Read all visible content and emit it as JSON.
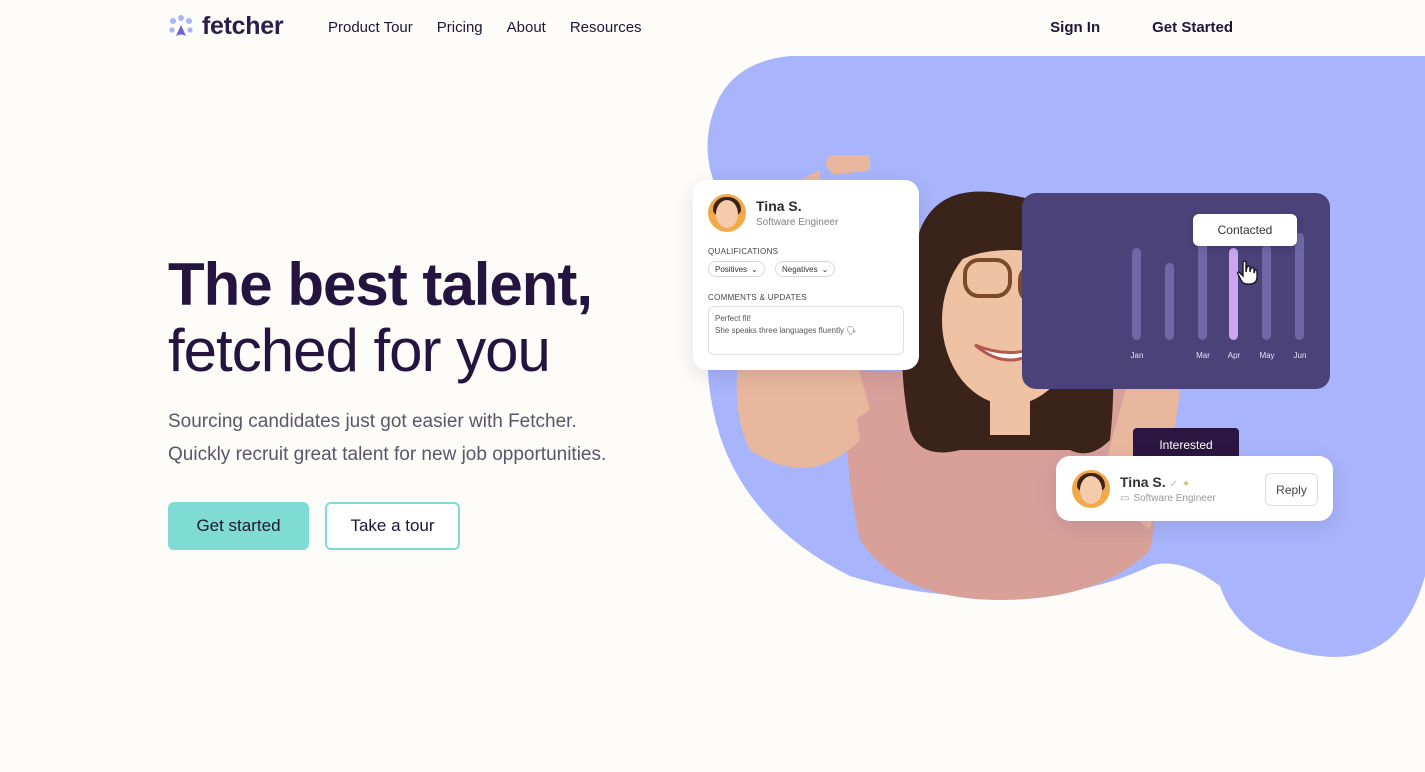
{
  "brand": {
    "name": "fetcher",
    "accent": "#7fdcd4",
    "blob_color": "#a8b4fb",
    "dark": "#24143f"
  },
  "nav": {
    "links": [
      "Product Tour",
      "Pricing",
      "About",
      "Resources"
    ],
    "sign_in": "Sign In",
    "get_started": "Get Started"
  },
  "hero": {
    "title_line1": "The best talent,",
    "title_line2": "fetched for you",
    "subtitle_line1": "Sourcing candidates just got easier with Fetcher.",
    "subtitle_line2": "Quickly recruit great talent for new job opportunities.",
    "cta_primary": "Get started",
    "cta_secondary": "Take a tour"
  },
  "profile_card": {
    "name": "Tina S.",
    "role": "Software Engineer",
    "qualifications_label": "QUALIFICATIONS",
    "positives_label": "Positives",
    "negatives_label": "Negatives",
    "comments_label": "COMMENTS & UPDATES",
    "comment_line1": "Perfect fit!",
    "comment_line2": "She speaks three languages fluently 🗣"
  },
  "chart_data": {
    "type": "bar",
    "categories": [
      "Jan",
      "",
      "Mar",
      "Apr",
      "May",
      "Jun"
    ],
    "highlighted": "Apr",
    "tooltip": "Contacted",
    "bar_color": "#7068a6",
    "highlight_color": "#c9a6ef",
    "background": "#4b4279"
  },
  "status_tooltip": "Interested",
  "reply_card": {
    "name": "Tina S.",
    "role": "Software Engineer",
    "reply_label": "Reply"
  }
}
